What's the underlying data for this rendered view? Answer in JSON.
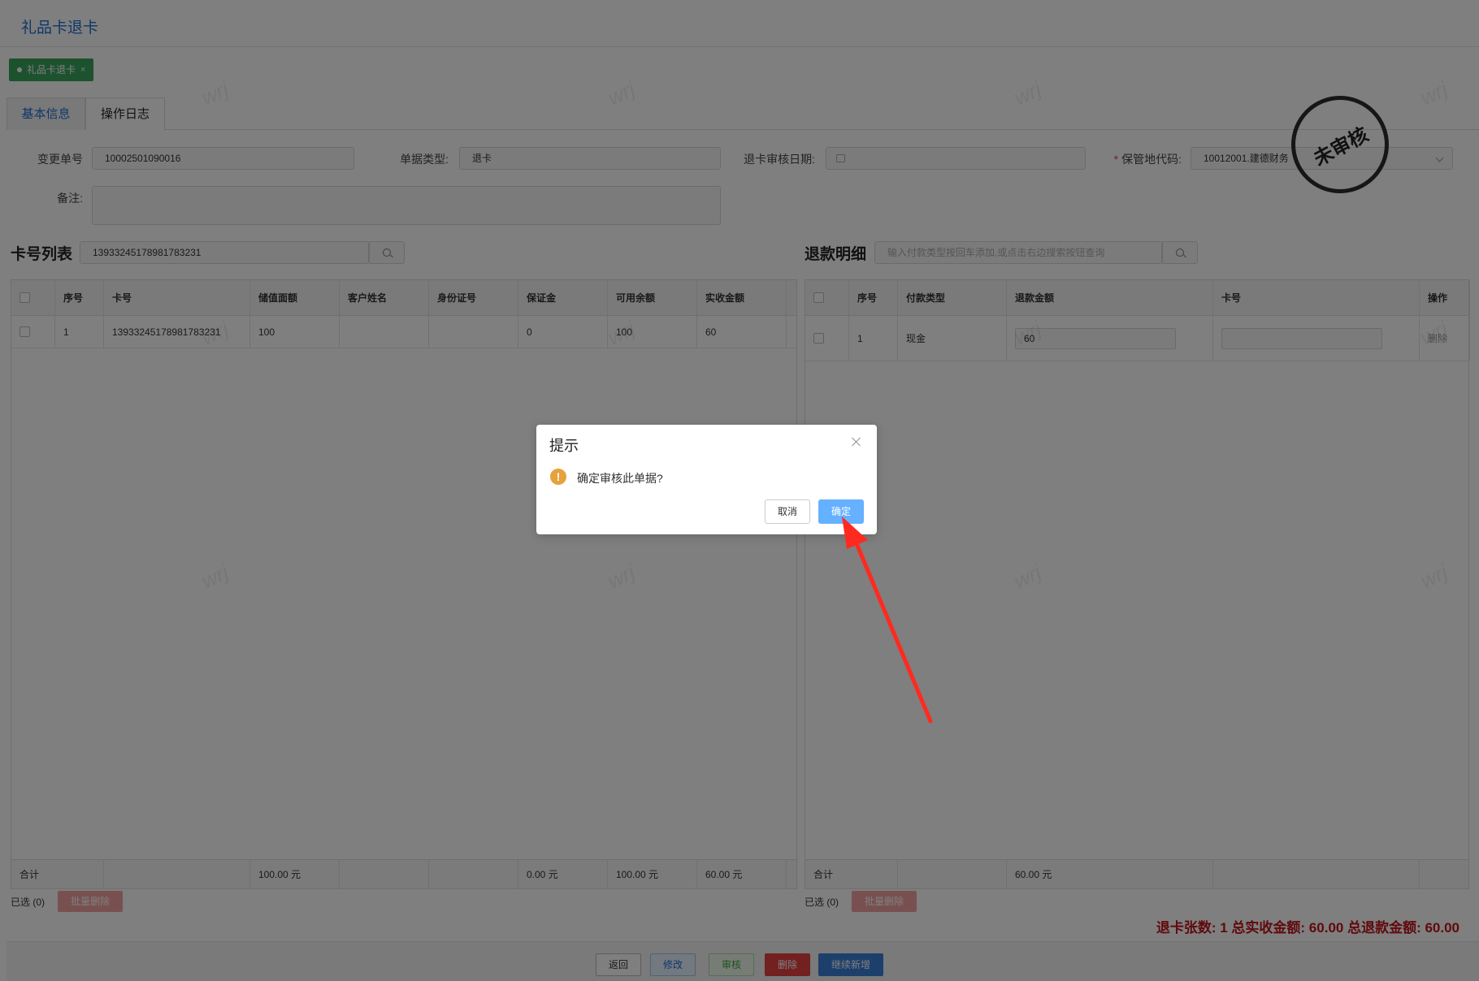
{
  "page": {
    "title": "礼品卡退卡",
    "tag_label": "礼品卡退卡",
    "tag_close": "×"
  },
  "tabs": [
    {
      "label": "基本信息"
    },
    {
      "label": "操作日志"
    }
  ],
  "form": {
    "change_no_label": "变更单号",
    "change_no_value": "10002501090016",
    "doc_type_label": "单据类型:",
    "doc_type_value": "退卡",
    "audit_date_label": "退卡审核日期:",
    "audit_date_value": "",
    "storage_label": "保管地代码:",
    "storage_value": "10012001.建德财务",
    "remark_label": "备注:",
    "remark_value": ""
  },
  "stamp_text": "未审核",
  "card_list": {
    "title": "卡号列表",
    "search_value": "13933245178981783231",
    "columns": [
      "序号",
      "卡号",
      "储值面额",
      "客户姓名",
      "身份证号",
      "保证金",
      "可用余额",
      "实收金额"
    ],
    "rows": [
      {
        "seq": "1",
        "card_no": "13933245178981783231",
        "face_value": "100",
        "customer": "",
        "id_no": "",
        "deposit": "0",
        "balance": "100",
        "received": "60"
      }
    ],
    "footer": {
      "label": "合计",
      "face_value": "100.00 元",
      "deposit": "0.00 元",
      "balance": "100.00 元",
      "received": "60.00 元"
    },
    "selected": "已选 (0)",
    "batch_delete": "批量删除"
  },
  "refund": {
    "title": "退款明细",
    "search_placeholder": "输入付款类型按回车添加,或点击右边搜索按钮查询",
    "columns": [
      "序号",
      "付款类型",
      "退款金额",
      "卡号",
      "操作"
    ],
    "rows": [
      {
        "seq": "1",
        "pay_type": "现金",
        "amount": "60",
        "card_no": "",
        "action": "删除"
      }
    ],
    "footer": {
      "label": "合计",
      "amount": "60.00 元"
    },
    "selected": "已选 (0)",
    "batch_delete": "批量删除"
  },
  "summary": "退卡张数: 1  总实收金额: 60.00  总退款金额: 60.00",
  "bottom_buttons": {
    "back": "返回",
    "edit": "修改",
    "audit": "审核",
    "delete": "删除",
    "continue_add": "继续新增"
  },
  "watermark_text": "wrj",
  "dialog": {
    "title": "提示",
    "message": "确定审核此单据?",
    "cancel": "取消",
    "ok": "确定",
    "warn_glyph": "!"
  },
  "colors": {
    "accent": "#1f6fd1",
    "tag_green": "#3aa55e",
    "danger": "#c0141a",
    "ok_button": "#66b1ff",
    "arrow": "#ff2a1f"
  }
}
